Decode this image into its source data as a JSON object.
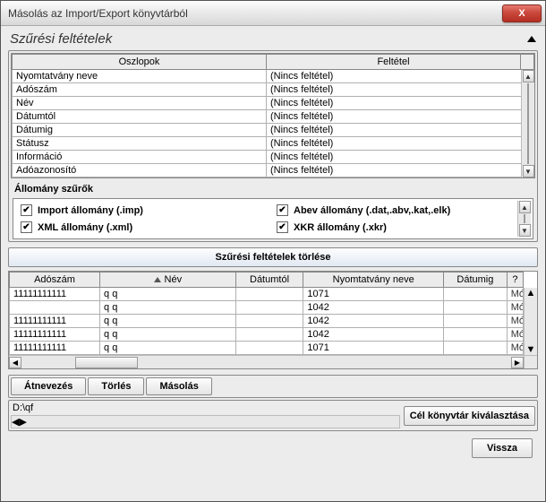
{
  "window": {
    "title": "Másolás az Import/Export könyvtárból",
    "close_symbol": "X"
  },
  "section": {
    "title": "Szűrési feltételek"
  },
  "filter_table": {
    "header_col": "Oszlopok",
    "header_cond": "Feltétel",
    "rows": [
      {
        "col": "Nyomtatvány neve",
        "cond": "(Nincs feltétel)"
      },
      {
        "col": "Adószám",
        "cond": "(Nincs feltétel)"
      },
      {
        "col": "Név",
        "cond": "(Nincs feltétel)"
      },
      {
        "col": "Dátumtól",
        "cond": "(Nincs feltétel)"
      },
      {
        "col": "Dátumig",
        "cond": "(Nincs feltétel)"
      },
      {
        "col": "Státusz",
        "cond": "(Nincs feltétel)"
      },
      {
        "col": "Információ",
        "cond": "(Nincs feltétel)"
      },
      {
        "col": "Adóazonosító",
        "cond": "(Nincs feltétel)"
      }
    ]
  },
  "file_filters": {
    "heading": "Állomány szűrők",
    "imp": "Import állomány (.imp)",
    "xml": "XML állomány (.xml)",
    "abev": "Abev állomány (.dat,.abv,.kat,.elk)",
    "xkr": "XKR állomány (.xkr)",
    "checked": true
  },
  "clear_button": "Szűrési feltételek törlése",
  "data_table": {
    "headers": {
      "adoszam": "Adószám",
      "nev": "Név",
      "datumtol": "Dátumtól",
      "nyomtatvany": "Nyomtatvány neve",
      "datumig": "Dátumig",
      "q": "?"
    },
    "rows": [
      {
        "adoszam": "11111111111",
        "nev": "q q",
        "datumtol": "",
        "nyomtatvany": "1071",
        "datumig": "",
        "q": "Mó"
      },
      {
        "adoszam": "",
        "nev": "q q",
        "datumtol": "",
        "nyomtatvany": "1042",
        "datumig": "",
        "q": "Mó"
      },
      {
        "adoszam": "11111111111",
        "nev": "q q",
        "datumtol": "",
        "nyomtatvany": "1042",
        "datumig": "",
        "q": "Mó"
      },
      {
        "adoszam": "11111111111",
        "nev": "q q",
        "datumtol": "",
        "nyomtatvany": "1042",
        "datumig": "",
        "q": "Mó"
      },
      {
        "adoszam": "11111111111",
        "nev": "q q",
        "datumtol": "",
        "nyomtatvany": "1071",
        "datumig": "",
        "q": "Mó"
      }
    ]
  },
  "toolbar": {
    "rename": "Átnevezés",
    "delete": "Törlés",
    "copy": "Másolás"
  },
  "path": {
    "value": "D:\\qf",
    "choose": "Cél könyvtár kiválasztása"
  },
  "footer": {
    "back": "Vissza"
  },
  "glyphs": {
    "check": "✔",
    "up": "▲",
    "down": "▼",
    "left": "◀",
    "right": "▶"
  }
}
